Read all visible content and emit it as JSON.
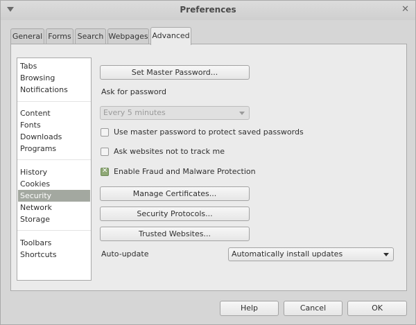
{
  "window": {
    "title": "Preferences"
  },
  "tabs": [
    {
      "label": "General"
    },
    {
      "label": "Forms"
    },
    {
      "label": "Search"
    },
    {
      "label": "Webpages"
    },
    {
      "label": "Advanced"
    }
  ],
  "active_tab": "Advanced",
  "sidebar": {
    "items": [
      {
        "label": "Tabs"
      },
      {
        "label": "Browsing"
      },
      {
        "label": "Notifications"
      },
      {
        "label": "Content"
      },
      {
        "label": "Fonts"
      },
      {
        "label": "Downloads"
      },
      {
        "label": "Programs"
      },
      {
        "label": "History"
      },
      {
        "label": "Cookies"
      },
      {
        "label": "Security"
      },
      {
        "label": "Network"
      },
      {
        "label": "Storage"
      },
      {
        "label": "Toolbars"
      },
      {
        "label": "Shortcuts"
      }
    ],
    "selected": "Security"
  },
  "security": {
    "set_master_password_label": "Set Master Password...",
    "ask_for_password_label": "Ask for password",
    "ask_for_password_value": "Every 5 minutes",
    "use_master_password_label": "Use master password to protect saved passwords",
    "use_master_password_checked": false,
    "do_not_track_label": "Ask websites not to track me",
    "do_not_track_checked": false,
    "fraud_protection_label": "Enable Fraud and Malware Protection",
    "fraud_protection_checked": true,
    "manage_certificates_label": "Manage Certificates...",
    "security_protocols_label": "Security Protocols...",
    "trusted_websites_label": "Trusted Websites...",
    "auto_update_label": "Auto-update",
    "auto_update_value": "Automatically install updates"
  },
  "footer": {
    "help_label": "Help",
    "cancel_label": "Cancel",
    "ok_label": "OK"
  },
  "colors": {
    "selection": "#a3a8a0",
    "checkbox_checked": "#8fa876",
    "window_bg": "#d6d6d6",
    "panel_bg": "#ebebeb"
  }
}
